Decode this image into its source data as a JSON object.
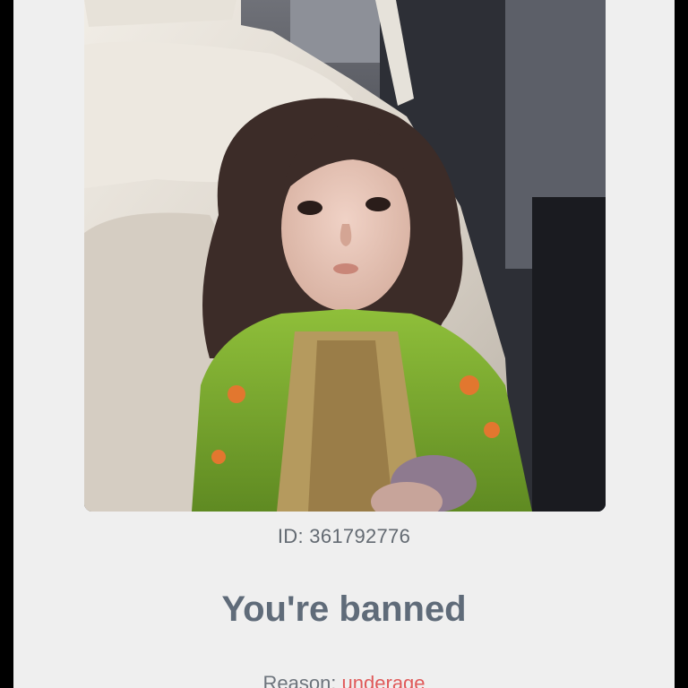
{
  "profile": {
    "photo_description": "child in green dress",
    "id_label": "ID:",
    "id_value": "361792776"
  },
  "ban": {
    "title": "You're banned",
    "reason_label": "Reason:",
    "reason_value": "underage"
  },
  "colors": {
    "screen_background": "#efefef",
    "title": "#5f6b79",
    "reason_value": "#e05a5a",
    "id_text": "#636a72"
  }
}
